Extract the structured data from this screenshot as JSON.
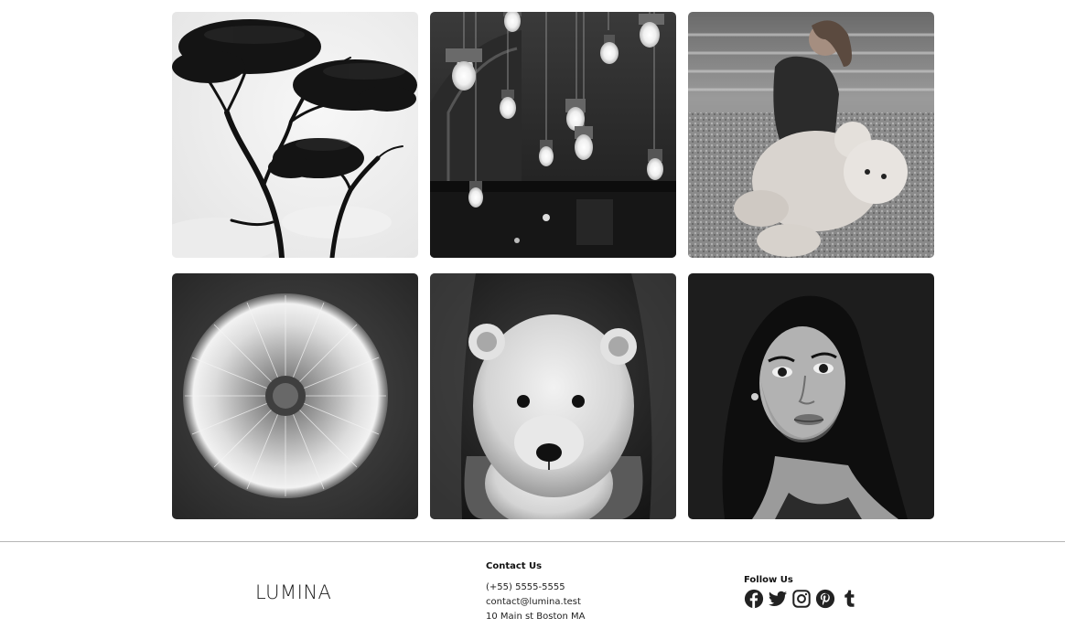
{
  "gallery": {
    "images": [
      {
        "subject": "tree-silhouette"
      },
      {
        "subject": "hanging-light-bulbs"
      },
      {
        "subject": "girl-with-teddy-bear"
      },
      {
        "subject": "dandelion"
      },
      {
        "subject": "polar-bear-cub"
      },
      {
        "subject": "woman-portrait"
      }
    ]
  },
  "footer": {
    "logo": "LUMINA",
    "contact": {
      "heading": "Contact Us",
      "phone": "(+55) 5555-5555",
      "email": "contact@lumina.test",
      "address": "10 Main st Boston MA"
    },
    "follow": {
      "heading": "Follow Us",
      "icons": [
        "facebook-icon",
        "twitter-icon",
        "instagram-icon",
        "pinterest-icon",
        "tumblr-icon"
      ]
    }
  },
  "colors": {
    "rule": "#b5b5b5",
    "icon": "#222222",
    "logo_glow": "#f6ede0"
  }
}
